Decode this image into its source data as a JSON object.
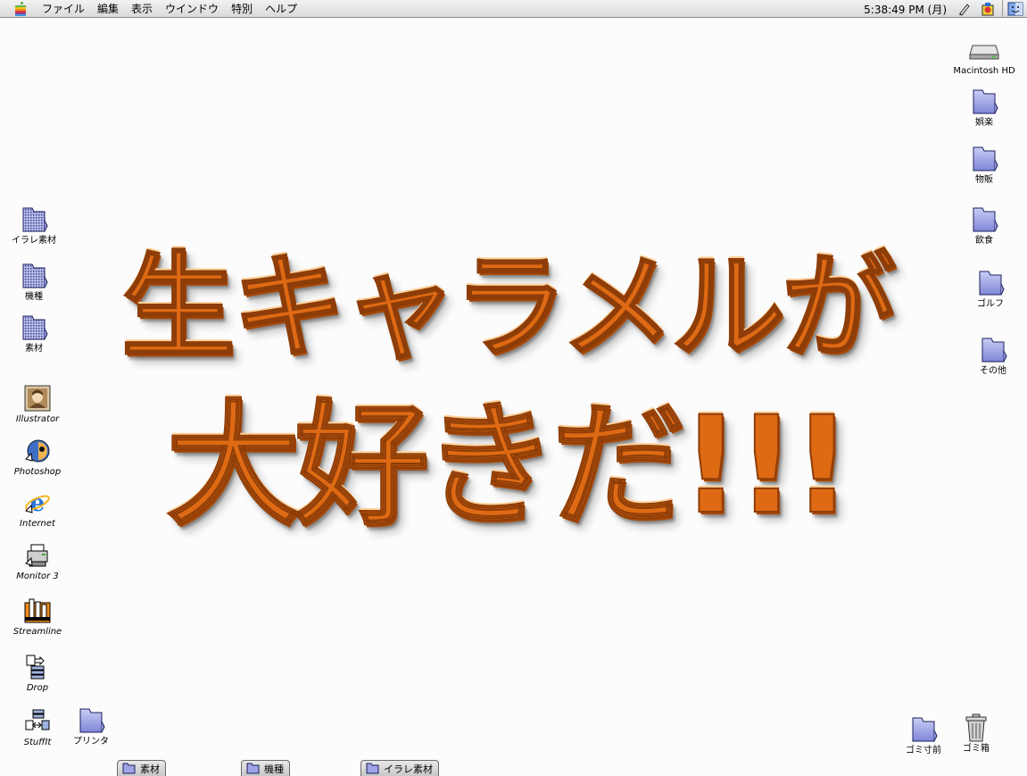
{
  "menubar": {
    "items": [
      "ファイル",
      "編集",
      "表示",
      "ウインドウ",
      "特別",
      "ヘルプ"
    ],
    "clock": "5:38:49 PM (月)"
  },
  "headline": {
    "line1": "生キャラメルが",
    "line2": "大好きだ!!!",
    "color": "#de6a14"
  },
  "left_icons": [
    {
      "label": "イラレ素材",
      "icon": "folder-alias-icon"
    },
    {
      "label": "機種",
      "icon": "folder-alias-icon"
    },
    {
      "label": "素材",
      "icon": "folder-alias-icon"
    },
    {
      "label": "Illustrator",
      "icon": "illustrator-icon"
    },
    {
      "label": "Photoshop",
      "icon": "photoshop-icon"
    },
    {
      "label": "Internet",
      "icon": "internet-explorer-icon"
    },
    {
      "label": "Monitor 3",
      "icon": "printer-monitor-icon"
    },
    {
      "label": "Streamline",
      "icon": "streamline-icon"
    },
    {
      "label": "Drop",
      "icon": "dropstuff-icon"
    },
    {
      "label": "StuffIt",
      "icon": "stuffit-icon"
    },
    {
      "label": "プリンタ",
      "icon": "folder-icon"
    }
  ],
  "right_icons": [
    {
      "label": "Macintosh HD",
      "icon": "hard-drive-icon"
    },
    {
      "label": "娯楽",
      "icon": "folder-icon"
    },
    {
      "label": "物販",
      "icon": "folder-icon"
    },
    {
      "label": "飲食",
      "icon": "folder-icon"
    },
    {
      "label": "ゴルフ",
      "icon": "folder-icon"
    },
    {
      "label": "その他",
      "icon": "folder-icon"
    },
    {
      "label": "ゴミ寸前",
      "icon": "folder-icon"
    },
    {
      "label": "ゴミ箱",
      "icon": "trash-icon"
    }
  ],
  "tabs": [
    "素材",
    "機種",
    "イラレ素材"
  ]
}
